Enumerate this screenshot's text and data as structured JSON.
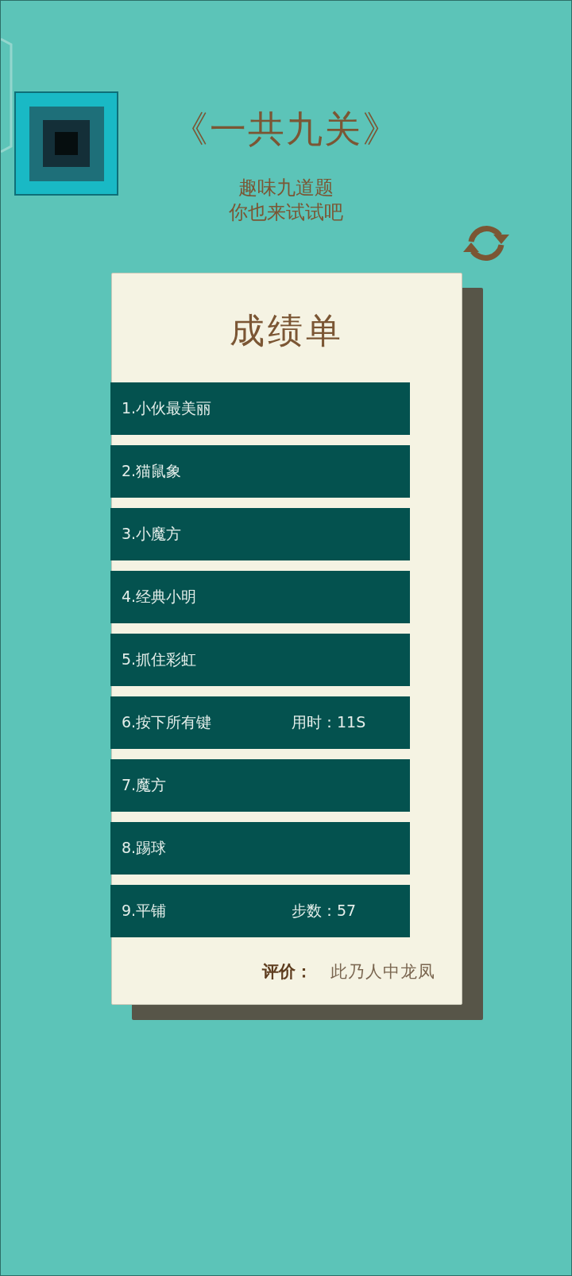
{
  "header": {
    "title": "《一共九关》",
    "subtitle": [
      "趣味九道题",
      "你也来试试吧"
    ]
  },
  "report_card": {
    "title": "成绩单",
    "levels": [
      {
        "name": "1.小伙最美丽"
      },
      {
        "name": "2.猫鼠象"
      },
      {
        "name": "3.小魔方"
      },
      {
        "name": "4.经典小明"
      },
      {
        "name": "5.抓住彩虹"
      },
      {
        "name": "6.按下所有键",
        "stat": "用时：11S"
      },
      {
        "name": "7.魔方"
      },
      {
        "name": "8.踢球"
      },
      {
        "name": "9.平铺",
        "stat": "步数：57"
      }
    ],
    "evaluation": {
      "label": "评价：",
      "value": "此乃人中龙凤"
    }
  }
}
